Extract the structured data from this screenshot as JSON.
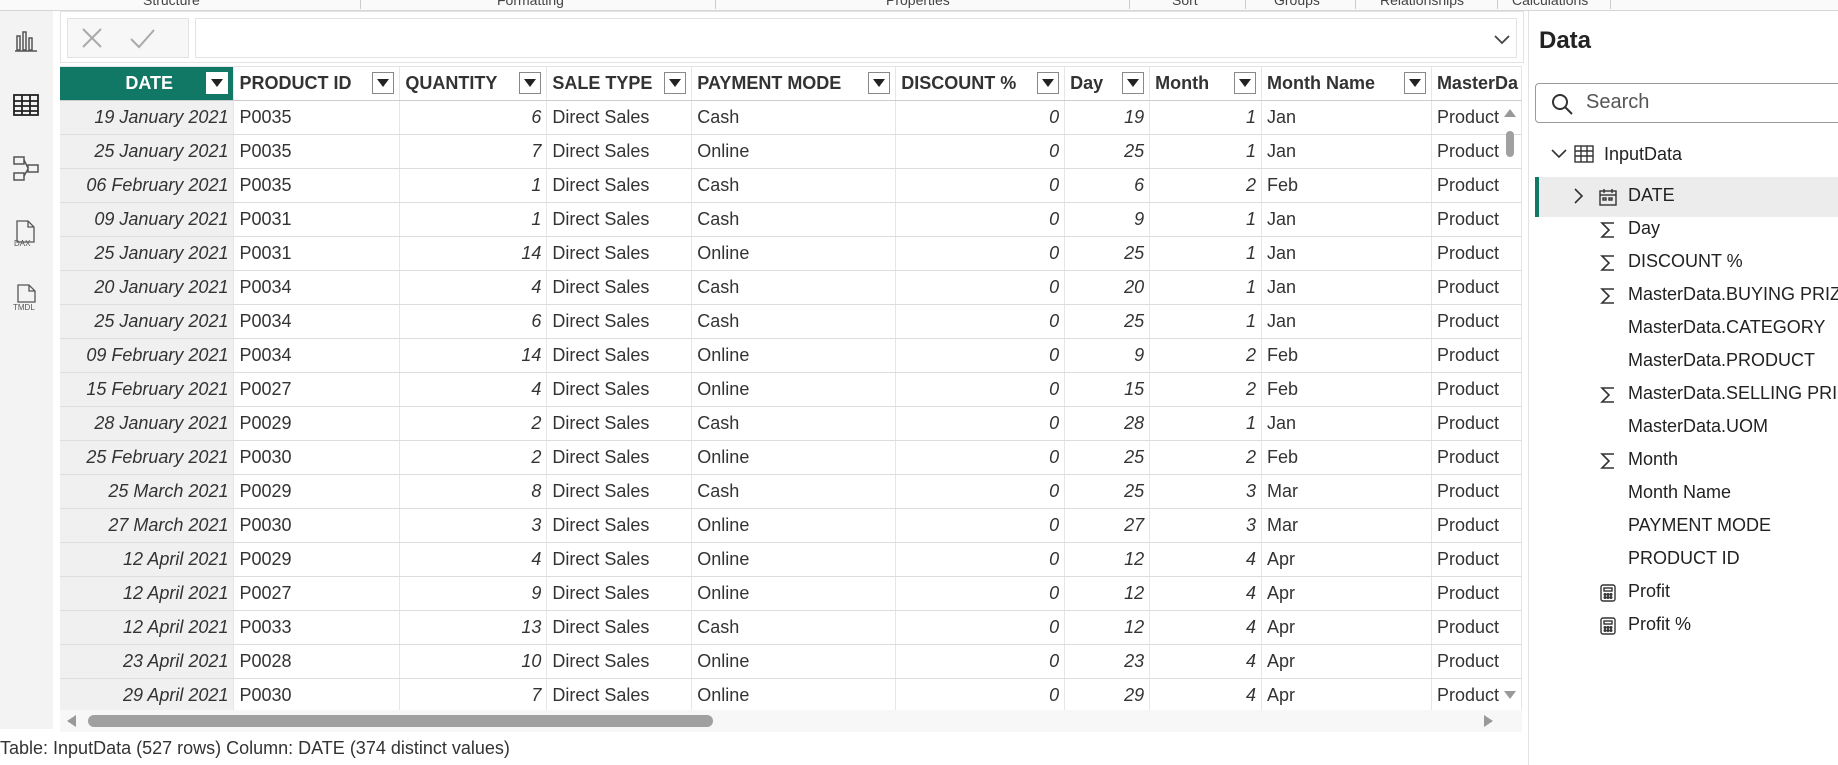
{
  "ribbon": {
    "labels": [
      "Structure",
      "Formatting",
      "Properties",
      "Sort",
      "Groups",
      "Relationships",
      "Calculations"
    ]
  },
  "grid": {
    "columns": [
      "DATE",
      "PRODUCT ID",
      "QUANTITY",
      "SALE TYPE",
      "PAYMENT MODE",
      "DISCOUNT %",
      "Day",
      "Month",
      "Month Name",
      "MasterDa"
    ],
    "rows": [
      [
        "19 January 2021",
        "P0035",
        "6",
        "Direct Sales",
        "Cash",
        "0",
        "19",
        "1",
        "Jan",
        "Product"
      ],
      [
        "25 January 2021",
        "P0035",
        "7",
        "Direct Sales",
        "Online",
        "0",
        "25",
        "1",
        "Jan",
        "Product"
      ],
      [
        "06 February 2021",
        "P0035",
        "1",
        "Direct Sales",
        "Cash",
        "0",
        "6",
        "2",
        "Feb",
        "Product"
      ],
      [
        "09 January 2021",
        "P0031",
        "1",
        "Direct Sales",
        "Cash",
        "0",
        "9",
        "1",
        "Jan",
        "Product"
      ],
      [
        "25 January 2021",
        "P0031",
        "14",
        "Direct Sales",
        "Online",
        "0",
        "25",
        "1",
        "Jan",
        "Product"
      ],
      [
        "20 January 2021",
        "P0034",
        "4",
        "Direct Sales",
        "Cash",
        "0",
        "20",
        "1",
        "Jan",
        "Product"
      ],
      [
        "25 January 2021",
        "P0034",
        "6",
        "Direct Sales",
        "Cash",
        "0",
        "25",
        "1",
        "Jan",
        "Product"
      ],
      [
        "09 February 2021",
        "P0034",
        "14",
        "Direct Sales",
        "Online",
        "0",
        "9",
        "2",
        "Feb",
        "Product"
      ],
      [
        "15 February 2021",
        "P0027",
        "4",
        "Direct Sales",
        "Online",
        "0",
        "15",
        "2",
        "Feb",
        "Product"
      ],
      [
        "28 January 2021",
        "P0029",
        "2",
        "Direct Sales",
        "Cash",
        "0",
        "28",
        "1",
        "Jan",
        "Product"
      ],
      [
        "25 February 2021",
        "P0030",
        "2",
        "Direct Sales",
        "Online",
        "0",
        "25",
        "2",
        "Feb",
        "Product"
      ],
      [
        "25 March 2021",
        "P0029",
        "8",
        "Direct Sales",
        "Cash",
        "0",
        "25",
        "3",
        "Mar",
        "Product"
      ],
      [
        "27 March 2021",
        "P0030",
        "3",
        "Direct Sales",
        "Online",
        "0",
        "27",
        "3",
        "Mar",
        "Product"
      ],
      [
        "12 April 2021",
        "P0029",
        "4",
        "Direct Sales",
        "Online",
        "0",
        "12",
        "4",
        "Apr",
        "Product"
      ],
      [
        "12 April 2021",
        "P0027",
        "9",
        "Direct Sales",
        "Online",
        "0",
        "12",
        "4",
        "Apr",
        "Product"
      ],
      [
        "12 April 2021",
        "P0033",
        "13",
        "Direct Sales",
        "Cash",
        "0",
        "12",
        "4",
        "Apr",
        "Product"
      ],
      [
        "23 April 2021",
        "P0028",
        "10",
        "Direct Sales",
        "Online",
        "0",
        "23",
        "4",
        "Apr",
        "Product"
      ],
      [
        "29 April 2021",
        "P0030",
        "7",
        "Direct Sales",
        "Online",
        "0",
        "29",
        "4",
        "Apr",
        "Product"
      ]
    ]
  },
  "status": {
    "text": "Table: InputData (527 rows) Column: DATE (374 distinct values)"
  },
  "data_panel": {
    "title": "Data",
    "search_placeholder": "Search",
    "table_name": "InputData",
    "fields": [
      {
        "label": "DATE",
        "icon": "calendar-icon"
      },
      {
        "label": "Day",
        "icon": "sigma-icon"
      },
      {
        "label": "DISCOUNT %",
        "icon": "sigma-icon"
      },
      {
        "label": "MasterData.BUYING PRIZ",
        "icon": "sigma-icon"
      },
      {
        "label": "MasterData.CATEGORY",
        "icon": ""
      },
      {
        "label": "MasterData.PRODUCT",
        "icon": ""
      },
      {
        "label": "MasterData.SELLING PRIC",
        "icon": "sigma-icon"
      },
      {
        "label": "MasterData.UOM",
        "icon": ""
      },
      {
        "label": "Month",
        "icon": "sigma-icon"
      },
      {
        "label": "Month Name",
        "icon": ""
      },
      {
        "label": "PAYMENT MODE",
        "icon": ""
      },
      {
        "label": "PRODUCT ID",
        "icon": ""
      },
      {
        "label": "Profit",
        "icon": "calculator-icon"
      },
      {
        "label": "Profit %",
        "icon": "calculator-icon"
      }
    ]
  },
  "colors": {
    "accent": "#117865"
  }
}
